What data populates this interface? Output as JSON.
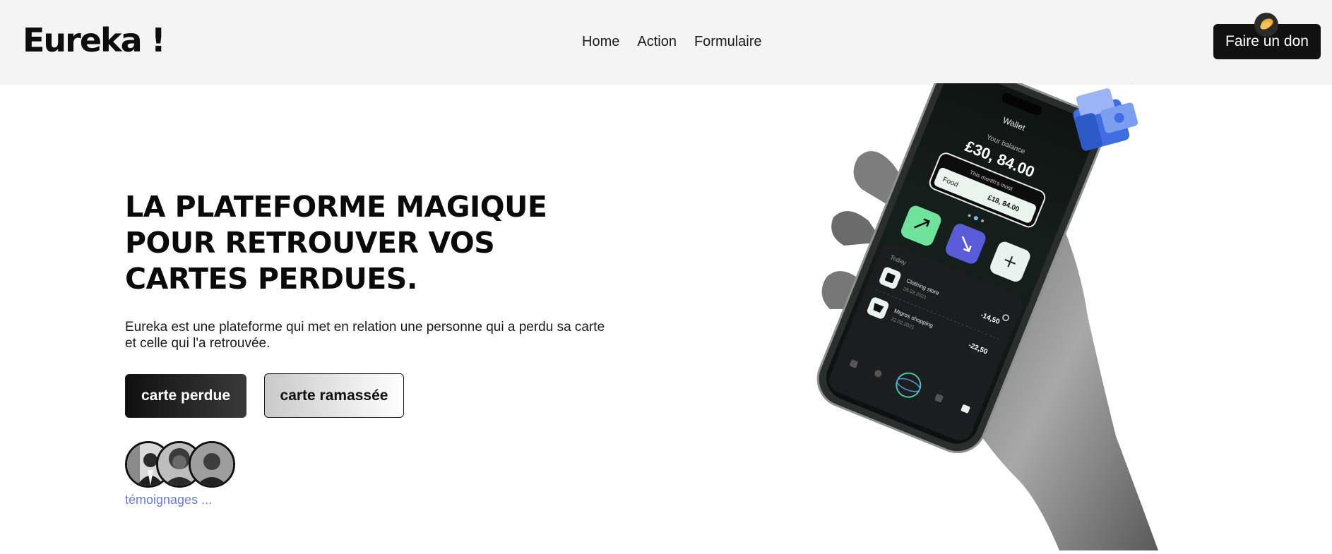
{
  "header": {
    "logo": "Eureka !",
    "nav": [
      "Home",
      "Action",
      "Formulaire"
    ],
    "donate_label": "Faire un don"
  },
  "hero": {
    "title_lines": [
      "LA PLATEFORME MAGIQUE",
      "POUR RETROUVER VOS",
      "CARTES PERDUES."
    ],
    "description_lines": [
      "Eureka est une plateforme qui met en relation une personne qui a perdu sa carte",
      "et celle qui l'a retrouvée."
    ],
    "btn_lost": "carte perdue",
    "btn_found": "carte ramassée",
    "testimonials_link": "témoignages ..."
  },
  "phone": {
    "app_title": "Wallet",
    "balance_label": "Your balance",
    "balance": "£30, 84.00",
    "month_label": "This month's most",
    "category": "Food",
    "category_amount": "£18, 84.00",
    "today_label": "Today",
    "transactions": [
      {
        "name": "Clothing store",
        "date": "28.02.2021",
        "amount": "-14,50"
      },
      {
        "name": "Migros shopping",
        "date": "22.02.2021",
        "amount": "-22,50"
      }
    ]
  },
  "colors": {
    "header_bg": "#f3f4f3",
    "accent_link": "#6a7bd4",
    "green_tile": "#6fe29b",
    "blue_tile": "#5a5bd8",
    "wallet_blue": "#3f6ee0"
  }
}
